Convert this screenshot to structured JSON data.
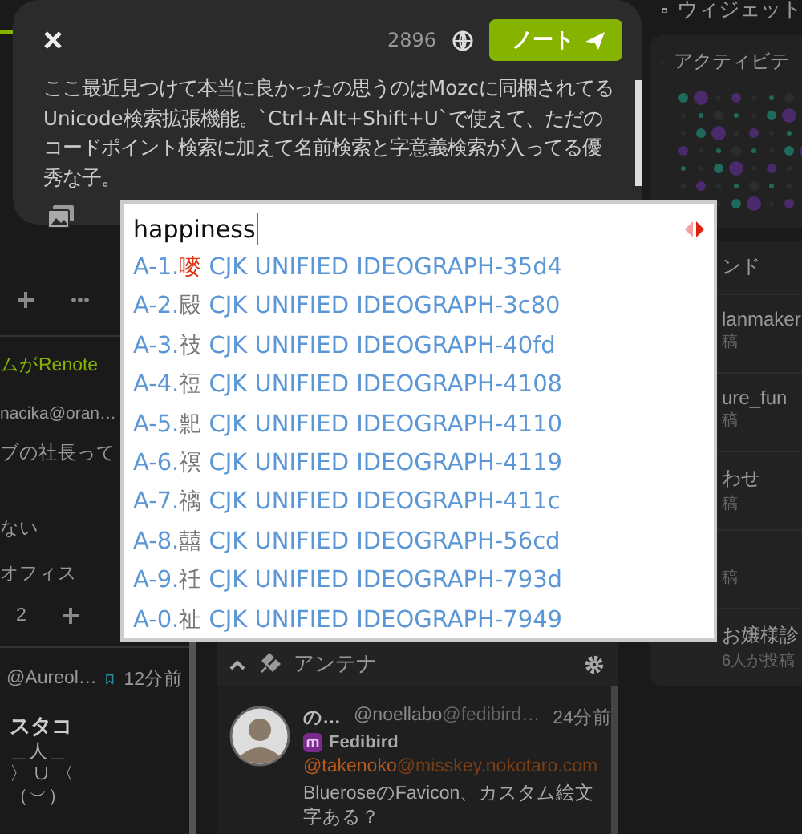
{
  "compose_dialog": {
    "char_count": "2896",
    "post_button": "ノート",
    "text": "ここ最近見つけて本当に良かったの思うのはMozcに同梱されてるUnicode検索拡張機能。`Ctrl+Alt+Shift+U`で使えて、ただのコードポイント検索に加えて名前検索と字意義検索が入ってる優秀な子。"
  },
  "ime_popup": {
    "input": "happiness",
    "candidates": [
      {
        "label": "A-1.",
        "char": "嘜",
        "name": "CJK UNIFIED IDEOGRAPH-35d4",
        "selected": true
      },
      {
        "label": "A-2.",
        "char": "㲀",
        "name": "CJK UNIFIED IDEOGRAPH-3c80",
        "selected": false
      },
      {
        "label": "A-3.",
        "char": "䃽",
        "name": "CJK UNIFIED IDEOGRAPH-40fd",
        "selected": false
      },
      {
        "label": "A-4.",
        "char": "䄈",
        "name": "CJK UNIFIED IDEOGRAPH-4108",
        "selected": false
      },
      {
        "label": "A-5.",
        "char": "䄐",
        "name": "CJK UNIFIED IDEOGRAPH-4110",
        "selected": false
      },
      {
        "label": "A-6.",
        "char": "䄙",
        "name": "CJK UNIFIED IDEOGRAPH-4119",
        "selected": false
      },
      {
        "label": "A-7.",
        "char": "䄜",
        "name": "CJK UNIFIED IDEOGRAPH-411c",
        "selected": false
      },
      {
        "label": "A-8.",
        "char": "囍",
        "name": "CJK UNIFIED IDEOGRAPH-56cd",
        "selected": false
      },
      {
        "label": "A-9.",
        "char": "祍",
        "name": "CJK UNIFIED IDEOGRAPH-793d",
        "selected": false
      },
      {
        "label": "A-0.",
        "char": "祉",
        "name": "CJK UNIFIED IDEOGRAPH-7949",
        "selected": false
      }
    ]
  },
  "left_timeline": {
    "renote_label": "ムがRenote",
    "user": "nacika@oran…",
    "text_lines": [
      "ブの社長って",
      "ない",
      "オフィス"
    ],
    "reaction_count": "2",
    "note": {
      "handle": "@Aureol…",
      "time": "12分前",
      "title": "スタコ",
      "art": [
        "＿人＿",
        "〉 ∪ 〈",
        "（︶）"
      ]
    }
  },
  "antenna": {
    "title": "アンテナ",
    "note": {
      "name": "の…",
      "handle": "@noellabo",
      "host": "@fedibird…",
      "time": "24分前",
      "instance": "Fedibird",
      "mention_user": "@takenoko",
      "mention_host": "@misskey.nokotaro.com",
      "text": "BlueroseのFavicon、カスタム絵文字ある？"
    }
  },
  "widgets": {
    "title": "ウィジェット",
    "activity_title": "アクティビテ",
    "trend_title": "ンド",
    "trends": [
      {
        "name": "lanmaker",
        "count": "稿"
      },
      {
        "name": "ure_fun",
        "count": "稿"
      },
      {
        "name": "わせ",
        "count": "稿"
      },
      {
        "count": "稿"
      },
      {
        "name": "お嬢様診",
        "count": "6人が投稿"
      }
    ]
  }
}
